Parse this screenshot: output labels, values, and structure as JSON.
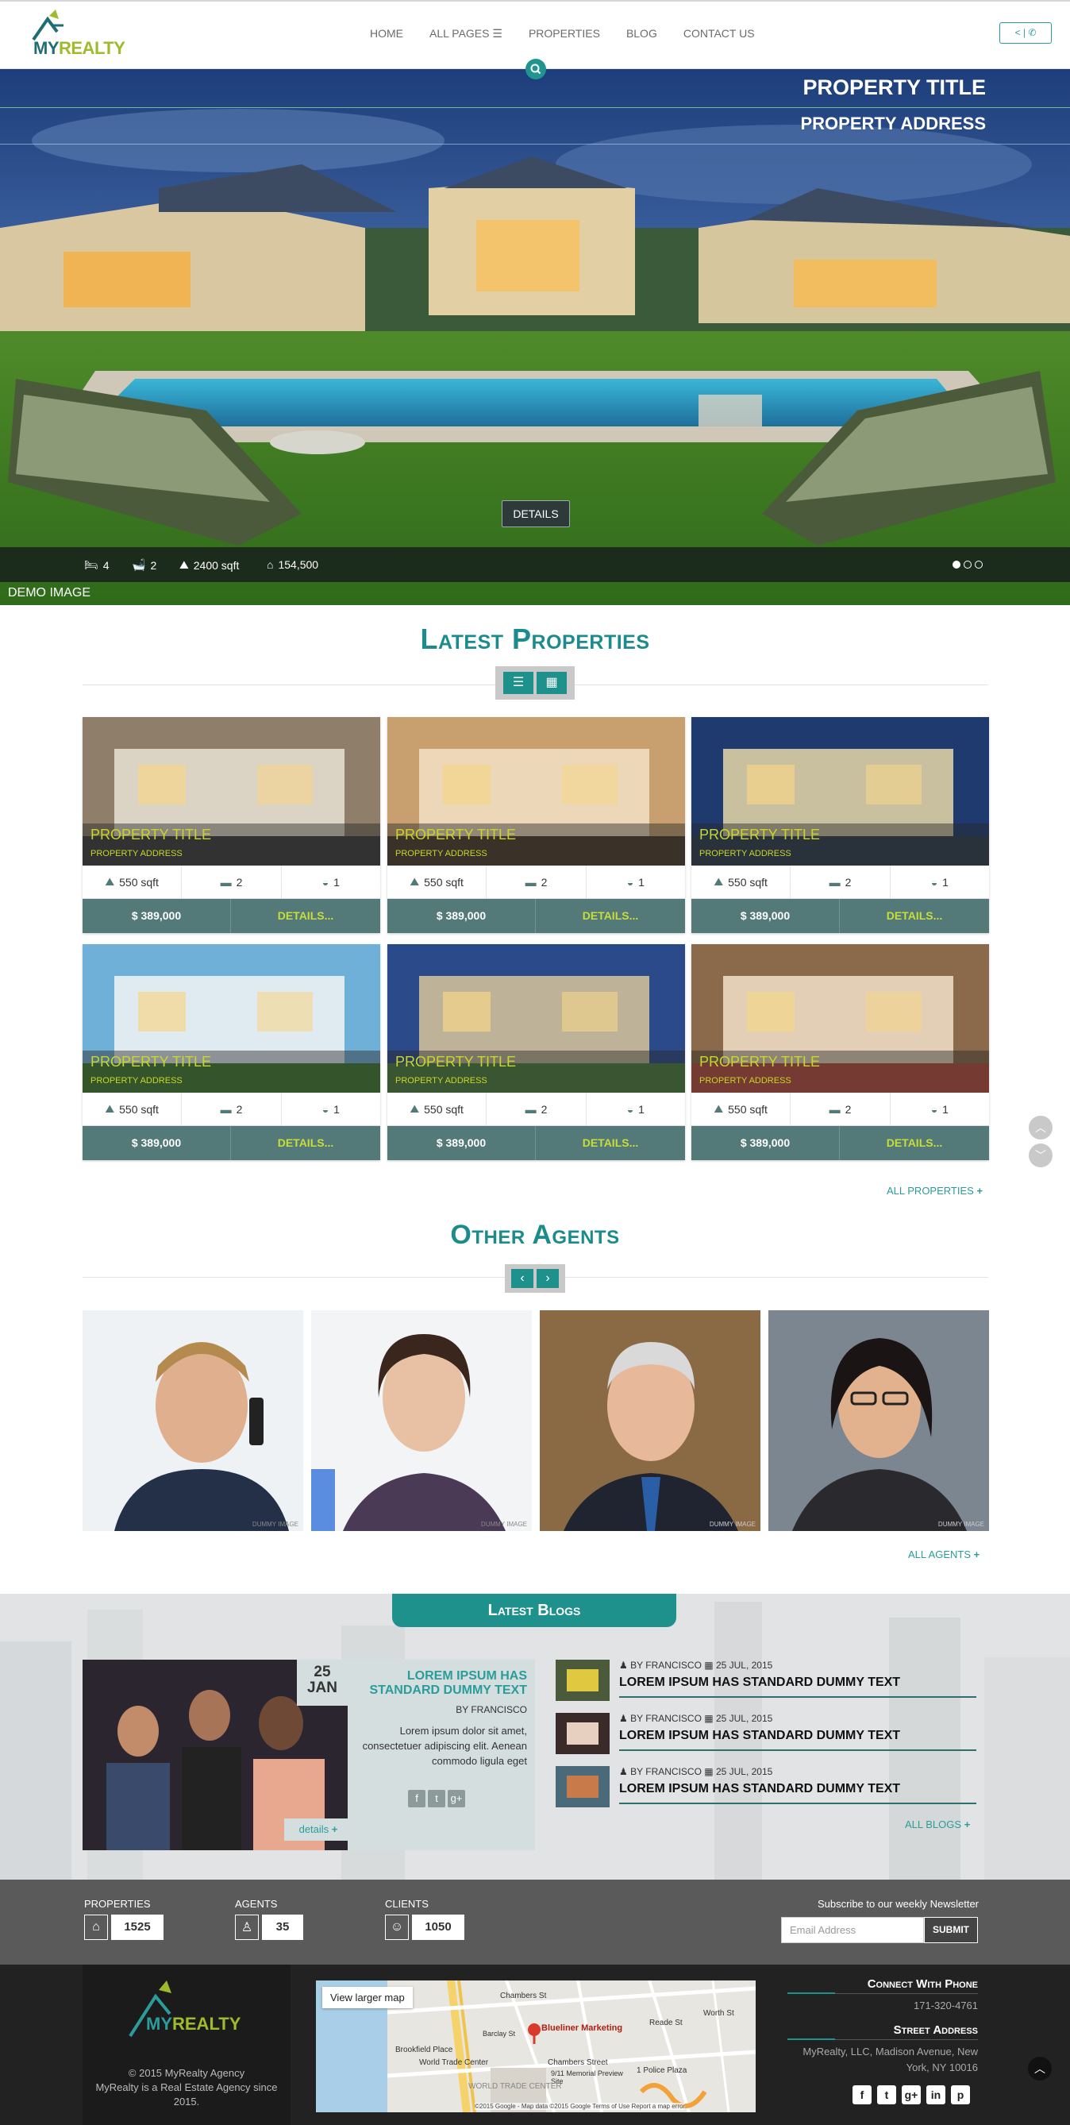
{
  "brand": {
    "name_part1": "MY",
    "name_part2": "REALTY"
  },
  "nav": {
    "home": "HOME",
    "all_pages": "ALL PAGES",
    "properties": "PROPERTIES",
    "blog": "BLOG",
    "contact": "CONTACT US"
  },
  "header": {
    "contact_btn": "< | ✆"
  },
  "hero": {
    "title": "PROPERTY TITLE",
    "address": "PROPERTY ADDRESS",
    "details_btn": "DETAILS",
    "beds": "4",
    "baths": "2",
    "area": "2400 sqft",
    "price": "154,500",
    "demo_label": "DEMO IMAGE"
  },
  "latest": {
    "title": "Latest Properties",
    "all_link": "ALL PROPERTIES",
    "cards": [
      {
        "title": "PROPERTY TITLE",
        "address": "PROPERTY ADDRESS",
        "area": "550 sqft",
        "beds": "2",
        "baths": "1",
        "price": "$ 389,000",
        "details": "DETAILS..."
      },
      {
        "title": "PROPERTY TITLE",
        "address": "PROPERTY ADDRESS",
        "area": "550 sqft",
        "beds": "2",
        "baths": "1",
        "price": "$ 389,000",
        "details": "DETAILS..."
      },
      {
        "title": "PROPERTY TITLE",
        "address": "PROPERTY ADDRESS",
        "area": "550 sqft",
        "beds": "2",
        "baths": "1",
        "price": "$ 389,000",
        "details": "DETAILS..."
      },
      {
        "title": "PROPERTY TITLE",
        "address": "PROPERTY ADDRESS",
        "area": "550 sqft",
        "beds": "2",
        "baths": "1",
        "price": "$ 389,000",
        "details": "DETAILS..."
      },
      {
        "title": "PROPERTY TITLE",
        "address": "PROPERTY ADDRESS",
        "area": "550 sqft",
        "beds": "2",
        "baths": "1",
        "price": "$ 389,000",
        "details": "DETAILS..."
      },
      {
        "title": "PROPERTY TITLE",
        "address": "PROPERTY ADDRESS",
        "area": "550 sqft",
        "beds": "2",
        "baths": "1",
        "price": "$ 389,000",
        "details": "DETAILS..."
      }
    ]
  },
  "agents": {
    "title": "Other Agents",
    "all_link": "ALL AGENTS",
    "watermark": "DUMMY IMAGE"
  },
  "blogs": {
    "tab": "Latest Blogs",
    "featured": {
      "day": "25",
      "month": "JAN",
      "title": "LOREM IPSUM HAS STANDARD DUMMY TEXT",
      "by": "BY FRANCISCO",
      "body": "Lorem ipsum dolor sit amet, consectetuer adipiscing elit. Aenean commodo ligula eget",
      "details": "details"
    },
    "items": [
      {
        "author": "BY FRANCISCO",
        "date": "25 JUL, 2015",
        "title": "LOREM IPSUM HAS STANDARD DUMMY TEXT"
      },
      {
        "author": "BY FRANCISCO",
        "date": "25 JUL, 2015",
        "title": "LOREM IPSUM HAS STANDARD DUMMY TEXT"
      },
      {
        "author": "BY FRANCISCO",
        "date": "25 JUL, 2015",
        "title": "LOREM IPSUM HAS STANDARD DUMMY TEXT"
      }
    ],
    "all_link": "ALL BLOGS"
  },
  "stats": {
    "properties_label": "PROPERTIES",
    "properties": "1525",
    "agents_label": "AGENTS",
    "agents": "35",
    "clients_label": "CLIENTS",
    "clients": "1050",
    "newsletter_label": "Subscribe to our weekly Newsletter",
    "email_placeholder": "Email Address",
    "submit": "SUBMIT"
  },
  "footer": {
    "copyright": "© 2015 MyRealty Agency",
    "about": "MyRealty is a Real Estate Agency since 2015.",
    "map_link": "View larger map",
    "map_pin": "Blueliner Marketing",
    "map_labels": [
      "Chambers St",
      "Brookfield Place",
      "World Trade Center",
      "Chambers Street",
      "Barclay St",
      "9/11 Memorial Preview Site",
      "1 Police Plaza",
      "Reade St",
      "Worth St",
      "WORLD TRADE CENTER"
    ],
    "map_footer": "©2015 Google - Map data ©2015 Google  Terms of Use  Report a map error",
    "phone_title": "Connect With Phone",
    "phone": "171-320-4761",
    "address_title": "Street Address",
    "address": "MyRealty, LLC, Madison Avenue, New York, NY 10016"
  },
  "colors": {
    "accent": "#1f918c",
    "lime": "#c8d62b",
    "card_bar": "#537a78"
  }
}
